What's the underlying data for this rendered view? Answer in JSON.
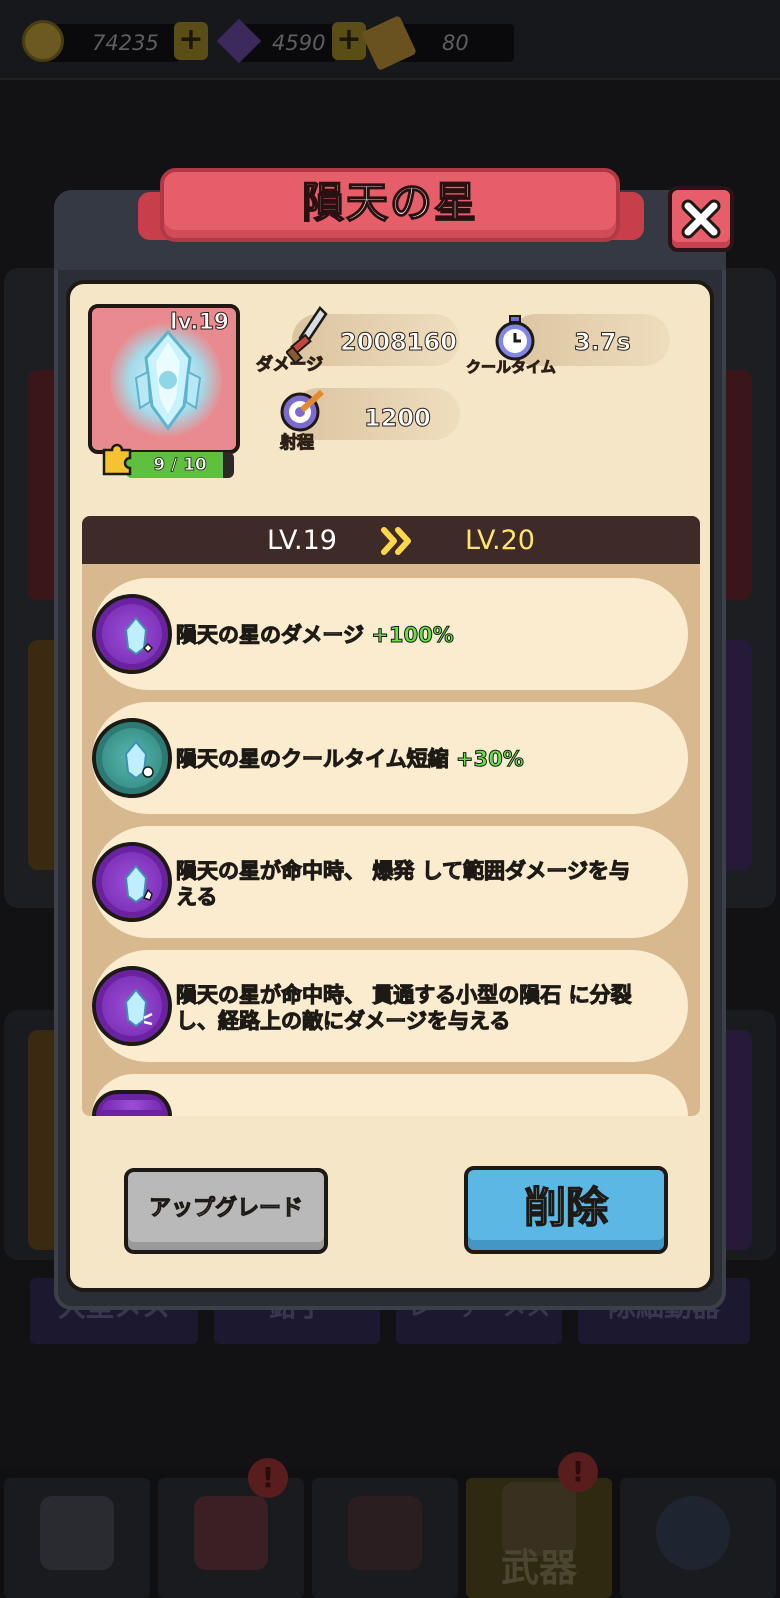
{
  "resources": {
    "coins": "74235",
    "gems": "4590",
    "tickets": "80"
  },
  "background_tabs": [
    "大型メス",
    "鉗子",
    "レーザーメス",
    "除細動器"
  ],
  "bottom_nav": {
    "active_label": "武器",
    "badge": "!"
  },
  "modal": {
    "title": "隕天の星",
    "close_symbol": "✕",
    "weapon": {
      "level": "lv.19",
      "shards": "9 / 10",
      "shard_fraction": 0.9
    },
    "stats": {
      "damage_label": "ダメージ",
      "damage_value": "2008160",
      "cooldown_label": "クールタイム",
      "cooldown_value": "3.7s",
      "range_label": "射程",
      "range_value": "1200"
    },
    "level_header": {
      "from": "LV.19",
      "to": "LV.20"
    },
    "perks": [
      {
        "icon": "crystal-damage-icon",
        "color": "purple",
        "text": "隕天の星のダメージ ",
        "highlight": "+100%",
        "suffix": ""
      },
      {
        "icon": "crystal-cooldown-icon",
        "color": "teal",
        "text": "隕天の星のクールタイム短縮 ",
        "highlight": "+30%",
        "suffix": ""
      },
      {
        "icon": "crystal-explode-icon",
        "color": "purple",
        "text": "隕天の星が命中時、 ",
        "highlight": "爆発",
        "suffix": " して範囲ダメージを与える"
      },
      {
        "icon": "crystal-split-icon",
        "color": "purple",
        "text": "隕天の星が命中時、 ",
        "highlight": "貫通する小型の隕石",
        "suffix": " に分裂し、経路上の敵にダメージを与える"
      }
    ],
    "buttons": {
      "upgrade": "アップグレード",
      "delete": "削除"
    },
    "colors": {
      "banner": "#e55e6a",
      "highlight": "#63e14a",
      "delete_button": "#5bb8e4",
      "upgrade_button": "#b9b9b9"
    }
  }
}
